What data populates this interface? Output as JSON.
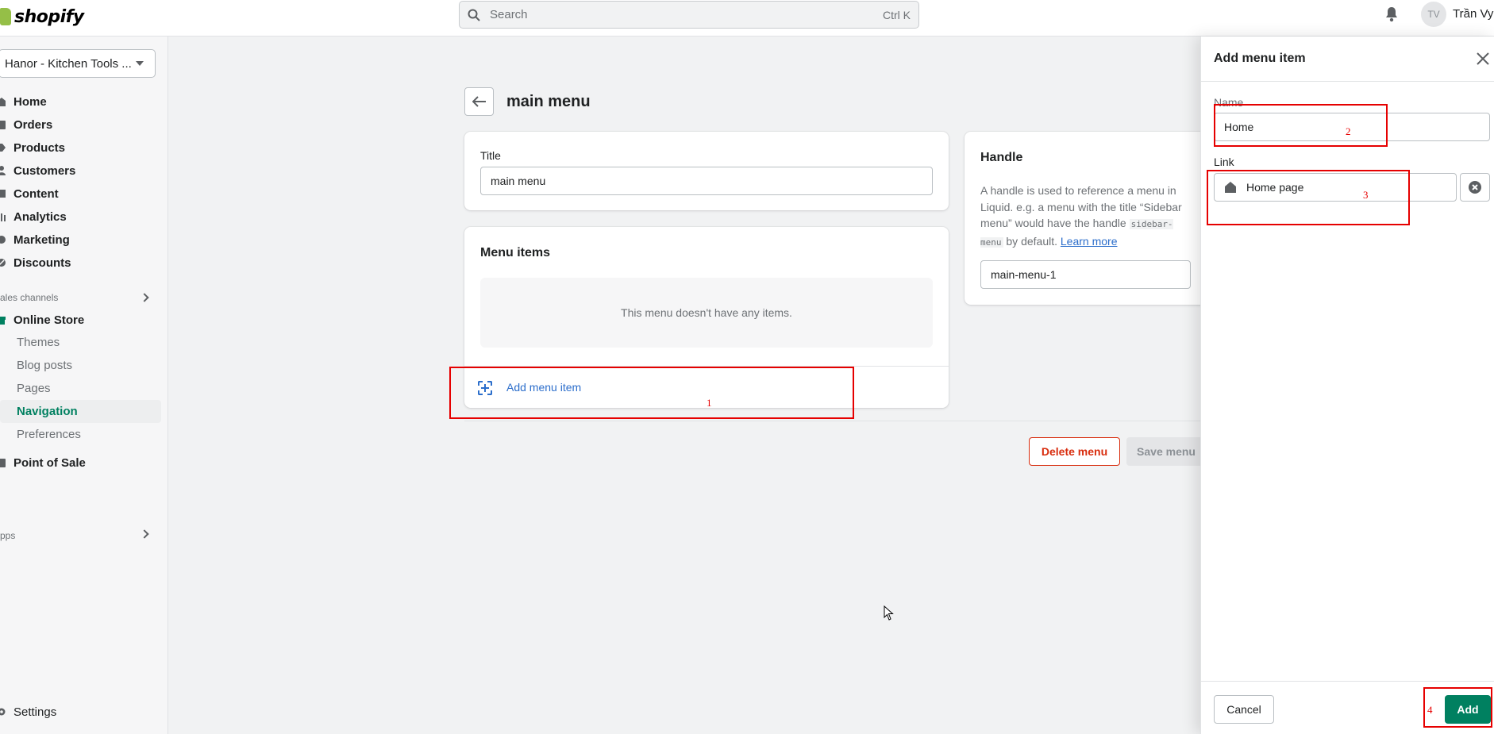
{
  "topbar": {
    "logo_text": "shopify",
    "search_placeholder": "Search",
    "search_shortcut": "Ctrl K",
    "avatar_initials": "TV",
    "user_name": "Trần Vy"
  },
  "sidebar": {
    "store_name": "Hanor - Kitchen Tools ...",
    "items": [
      {
        "label": "Home",
        "icon": "home-icon"
      },
      {
        "label": "Orders",
        "icon": "orders-icon"
      },
      {
        "label": "Products",
        "icon": "tag-icon"
      },
      {
        "label": "Customers",
        "icon": "person-icon"
      },
      {
        "label": "Content",
        "icon": "content-icon"
      },
      {
        "label": "Analytics",
        "icon": "analytics-icon"
      },
      {
        "label": "Marketing",
        "icon": "marketing-icon"
      },
      {
        "label": "Discounts",
        "icon": "discount-icon"
      }
    ],
    "sales_channels_label": "ales channels",
    "online_store_label": "Online Store",
    "online_store_sub": [
      "Themes",
      "Blog posts",
      "Pages",
      "Navigation",
      "Preferences"
    ],
    "active_sub": "Navigation",
    "pos_label": "Point of Sale",
    "apps_label": "pps",
    "settings_label": "Settings"
  },
  "main": {
    "page_title": "main menu",
    "title_label": "Title",
    "title_value": "main menu",
    "menu_items_title": "Menu items",
    "empty_text": "This menu doesn't have any items.",
    "add_item_label": "Add menu item",
    "handle_title": "Handle",
    "handle_desc_1": "A handle is used to reference a menu in Liquid. e.g. a menu with the title “Sidebar menu” would have the handle ",
    "handle_code": "sidebar-menu",
    "handle_desc_2": " by default. ",
    "handle_learn_more": "Learn more",
    "handle_value": "main-menu-1",
    "delete_label": "Delete menu",
    "save_label": "Save menu"
  },
  "drawer": {
    "title": "Add menu item",
    "name_label": "Name",
    "name_value": "Home",
    "link_label": "Link",
    "link_value": "Home page",
    "cancel_label": "Cancel",
    "add_label": "Add"
  },
  "annotations": [
    "1",
    "2",
    "3",
    "4"
  ],
  "colors": {
    "primary": "#008060",
    "link": "#2c6ecb",
    "critical": "#d82c0d",
    "annotation": "#e60000"
  }
}
